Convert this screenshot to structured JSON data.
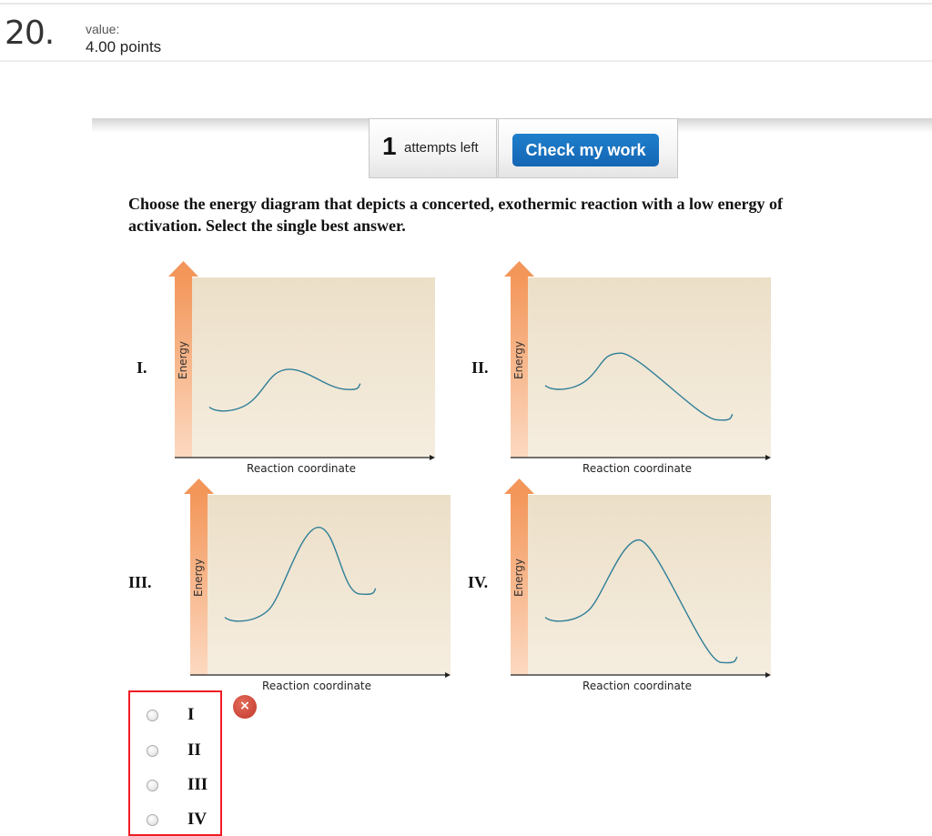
{
  "question": {
    "number": "20.",
    "value_label": "value:",
    "value": "4.00 points"
  },
  "attempts": {
    "count": "1",
    "label": "attempts left",
    "check_button": "Check my work"
  },
  "prompt": "Choose the energy diagram that depicts a concerted, exothermic reaction with a low energy of activation. Select the single best answer.",
  "diagrams": [
    {
      "numeral": "I.",
      "y_label": "Energy",
      "x_label": "Reaction coordinate",
      "reactant_energy": 0.26,
      "transition_energy": 0.49,
      "product_energy": 0.39
    },
    {
      "numeral": "II.",
      "y_label": "Energy",
      "x_label": "Reaction coordinate",
      "reactant_energy": 0.38,
      "transition_energy": 0.58,
      "product_energy": 0.22
    },
    {
      "numeral": "III.",
      "y_label": "Energy",
      "x_label": "Reaction coordinate",
      "reactant_energy": 0.3,
      "transition_energy": 0.82,
      "product_energy": 0.46
    },
    {
      "numeral": "IV.",
      "y_label": "Energy",
      "x_label": "Reaction coordinate",
      "reactant_energy": 0.3,
      "transition_energy": 0.75,
      "product_energy": 0.08
    }
  ],
  "options": [
    "I",
    "II",
    "III",
    "IV"
  ],
  "selected_option": null,
  "result_icon": "×",
  "colors": {
    "accent_button": "#1a73c2",
    "curve": "#2f7f98",
    "panel": "#efe4cf",
    "arrow": "#f39a5e",
    "error_outline": "#ee1c25",
    "wrong_badge": "#d14a3b"
  }
}
